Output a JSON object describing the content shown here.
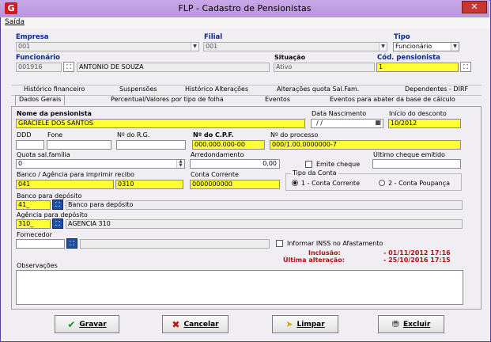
{
  "window": {
    "title": "FLP - Cadastro de Pensionistas",
    "icon": "app-logo-icon",
    "close": "✕"
  },
  "menu": {
    "saida": "Saída"
  },
  "header": {
    "empresa_label": "Empresa",
    "empresa_value": "001",
    "filial_label": "Filial",
    "filial_value": "001",
    "tipo_label": "Tipo",
    "tipo_value": "Funcionário",
    "funcionario_label": "Funcionário",
    "funcionario_code": "001916",
    "funcionario_name": "ANTONIO DE SOUZA",
    "situacao_label": "Situação",
    "situacao_value": "Ativo",
    "cod_pens_label": "Cód. pensionista",
    "cod_pens_value": "1"
  },
  "tabs_row1": [
    "Histórico financeiro",
    "Suspensões",
    "Histórico Alterações",
    "Alterações quota Sal.Fam.",
    "Dependentes - DIRF"
  ],
  "tabs_row2": [
    "Dados Gerais",
    "Percentual/Valores por tipo de folha",
    "Eventos",
    "Eventos para abater da base de cálculo"
  ],
  "form": {
    "nome_label": "Nome da pensionista",
    "nome_value": "GRACIELE DOS SANTOS",
    "nasc_label": "Data Nascimento",
    "nasc_value": "/ /",
    "inicio_label": "Início do desconto",
    "inicio_value": "10/2012",
    "ddd_label": "DDD",
    "fone_label": "Fone",
    "rg_label": "Nº do R.G.",
    "cpf_label": "Nº do C.P.F.",
    "cpf_value": "000.000.000-00",
    "processo_label": "Nº do processo",
    "processo_value": "000/1.00.0000000-7",
    "quota_label": "Quota sal.família",
    "quota_value": "0",
    "arred_label": "Arredondamento",
    "arred_value": "0,00",
    "emite_label": "Emite cheque",
    "ultimo_label": "Último cheque emitido",
    "banco_ag_label": "Banco / Agência para imprimir recibo",
    "banco_value": "041",
    "agencia_value": "0310",
    "conta_label": "Conta Corrente",
    "conta_value": "0000000000",
    "tipo_conta_label": "Tipo da Conta",
    "radio1": "1 - Conta Corrente",
    "radio2": "2 - Conta Poupança",
    "banco_dep_label": "Banco para depósito",
    "banco_dep_value": "41_",
    "banco_dep_name": "Banco para depósito",
    "ag_dep_label": "Agência para depósito",
    "ag_dep_value": "310_",
    "ag_dep_name": "AGENCIA 310",
    "fornecedor_label": "Fornecedor",
    "inss_label": "Informar INSS no Afastamento",
    "inclusao_label": "Inclusão:",
    "inclusao_value": "- 01/11/2012 17:16",
    "alteracao_label": "Última alteração:",
    "alteracao_value": "- 25/10/2016 17:15",
    "obs_label": "Observações"
  },
  "buttons": {
    "gravar": "Gravar",
    "cancelar": "Cancelar",
    "limpar": "Limpar",
    "excluir": "Excluir"
  }
}
